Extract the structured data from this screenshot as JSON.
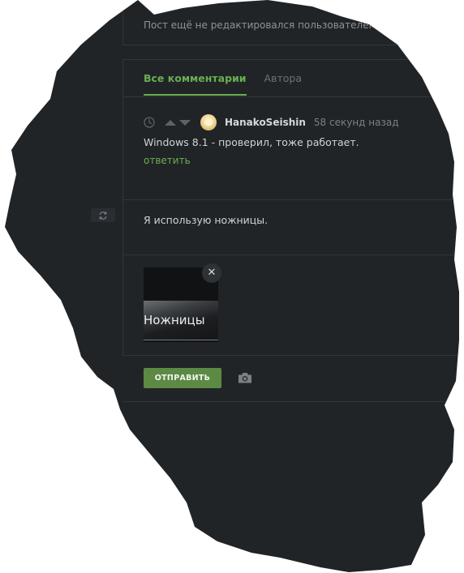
{
  "post": {
    "edit_note": "Пост ещё не редактировался пользователем"
  },
  "comments": {
    "tabs": [
      {
        "label": "Все комментарии",
        "active": true
      },
      {
        "label": "Автора",
        "active": false
      }
    ],
    "items": [
      {
        "author": "HanakoSeishin",
        "time": "58 секунд назад",
        "text": "Windows 8.1 - проверил, тоже работает.",
        "reply_label": "ответить"
      }
    ]
  },
  "composer": {
    "text": "Я использую ножницы.",
    "attachment": {
      "label": "Ножницы",
      "remove_icon": "close-icon"
    },
    "submit_label": "ОТПРАВИТЬ",
    "camera_icon": "camera-icon",
    "refresh_icon": "refresh-icon"
  },
  "colors": {
    "background": "#212427",
    "accent": "#6aae52",
    "button": "#5c8a44",
    "text": "#d0d3d6",
    "muted": "#7b8086"
  }
}
